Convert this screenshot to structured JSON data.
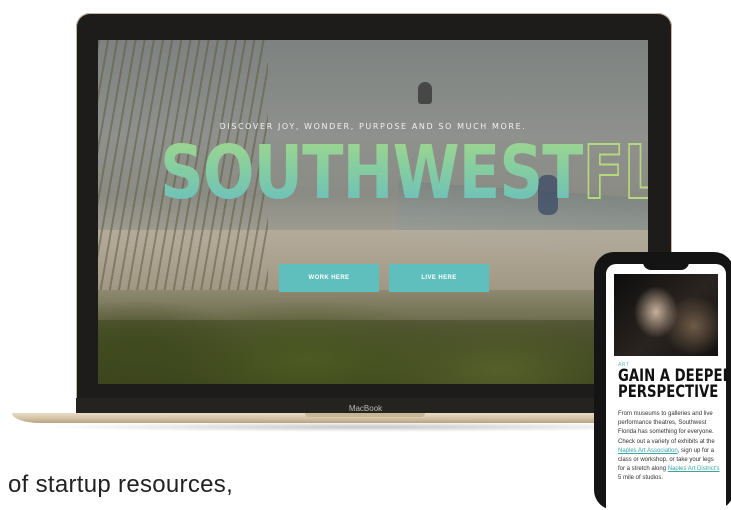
{
  "hero": {
    "tagline": "DISCOVER JOY, WONDER, PURPOSE AND SO MUCH MORE.",
    "headline_main": "SOUTHWEST",
    "headline_outline": "FL",
    "buttons": {
      "work_here": "WORK HERE",
      "live_here": "LIVE HERE"
    },
    "colors": {
      "accent": "#5fbfbd",
      "headline_top": "#a7d88a",
      "headline_bottom": "#64bcc6"
    }
  },
  "device": {
    "laptop_label": "MacBook"
  },
  "caption": {
    "text": "of startup resources,"
  },
  "phone": {
    "category": "ART",
    "title_line1": "GAIN A DEEPER",
    "title_line2": "PERSPECTIVE",
    "body": {
      "part1": "From museums to galleries and live performance theatres, Southwest Florida has something for everyone. Check out a variety of exhibits at the ",
      "link1": "Naples Art Association",
      "part2": ", sign up for a class or workshop, or take your legs for a stretch along ",
      "link2": "Naples Art District's",
      "part3": " 5 mile of studios."
    }
  }
}
